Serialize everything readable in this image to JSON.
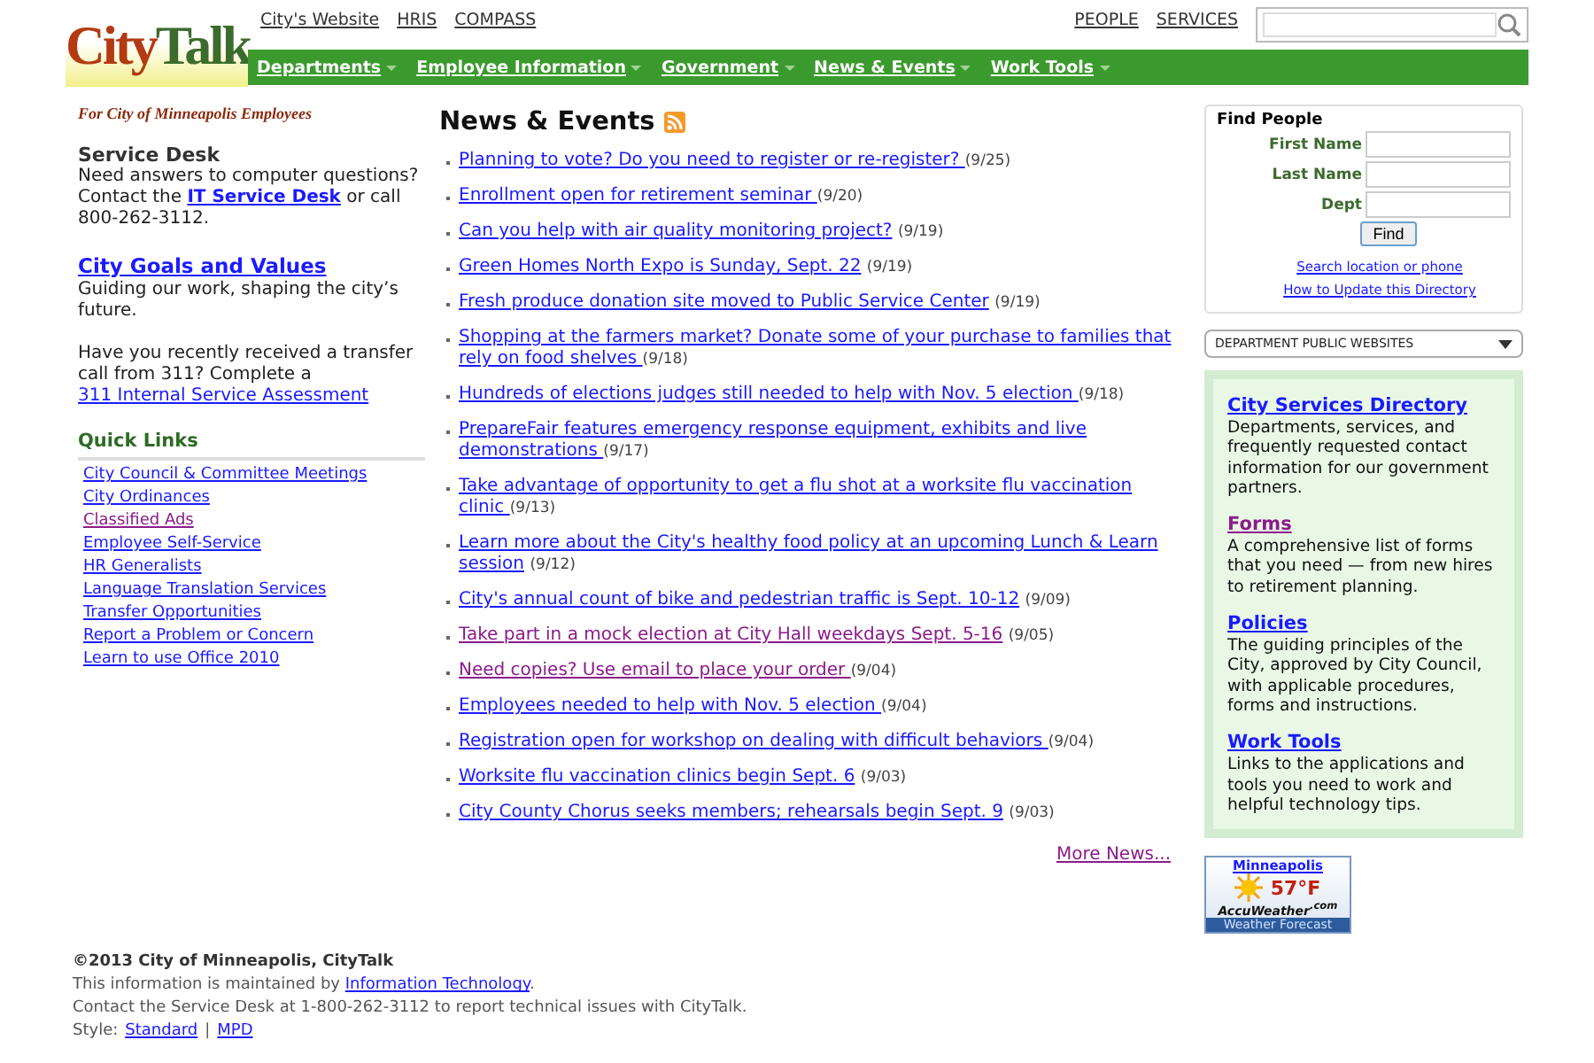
{
  "logo": {
    "first": "City",
    "second": "Talk"
  },
  "top_links": [
    {
      "label": "City's Website"
    },
    {
      "label": "HRIS"
    },
    {
      "label": "COMPASS"
    }
  ],
  "top_right_links": [
    {
      "label": "PEOPLE"
    },
    {
      "label": "SERVICES"
    }
  ],
  "nav": [
    {
      "label": "Departments"
    },
    {
      "label": "Employee Information"
    },
    {
      "label": "Government"
    },
    {
      "label": "News & Events"
    },
    {
      "label": "Work Tools"
    }
  ],
  "tagline": "For City of Minneapolis Employees",
  "service_desk": {
    "title": "Service Desk",
    "line": "Need answers to computer questions?",
    "before": "Contact the",
    "link": "IT Service Desk",
    "after": "or call 800-262-3112."
  },
  "goals": {
    "link": "City Goals and Values",
    "text": "Guiding our work, shaping the city’s future."
  },
  "transfer": {
    "before": "Have you recently received a transfer call from 311? Complete a",
    "link": "311 Internal Service Assessment"
  },
  "quick_links": {
    "title": "Quick Links",
    "items": [
      {
        "label": "City Council & Committee Meetings",
        "visited": false
      },
      {
        "label": "City Ordinances",
        "visited": false
      },
      {
        "label": "Classified Ads",
        "visited": true
      },
      {
        "label": "Employee Self-Service",
        "visited": false
      },
      {
        "label": "HR Generalists",
        "visited": false
      },
      {
        "label": "Language Translation Services",
        "visited": false
      },
      {
        "label": "Transfer Opportunities",
        "visited": false
      },
      {
        "label": "Report a Problem or Concern",
        "visited": false
      },
      {
        "label": "Learn to use Office 2010",
        "visited": false
      }
    ]
  },
  "news": {
    "title": "News & Events",
    "items": [
      {
        "label": "Planning to vote? Do you need to register or re-register? ",
        "date": "(9/25)",
        "visited": false
      },
      {
        "label": "Enrollment open for retirement seminar ",
        "date": "(9/20)",
        "visited": false
      },
      {
        "label": "Can you help with air quality monitoring project?",
        "date": "(9/19)",
        "visited": false
      },
      {
        "label": "Green Homes North Expo is Sunday, Sept. 22",
        "date": "(9/19)",
        "visited": false
      },
      {
        "label": "Fresh produce donation site moved to Public Service Center",
        "date": "(9/19)",
        "visited": false
      },
      {
        "label": "Shopping at the farmers market? Donate some of your purchase to families that rely on food shelves ",
        "date": "(9/18)",
        "visited": false
      },
      {
        "label": "Hundreds of elections judges still needed to help with Nov. 5 election ",
        "date": "(9/18)",
        "visited": false
      },
      {
        "label": "PrepareFair features emergency response equipment, exhibits and live demonstrations ",
        "date": "(9/17)",
        "visited": false
      },
      {
        "label": "Take advantage of opportunity to get a flu shot at a worksite flu vaccination clinic ",
        "date": "(9/13)",
        "visited": false
      },
      {
        "label": "Learn more about the City's healthy food policy at an upcoming Lunch & Learn session",
        "date": "(9/12)",
        "visited": false
      },
      {
        "label": "City's annual count of bike and pedestrian traffic is Sept. 10-12",
        "date": "(9/09)",
        "visited": false
      },
      {
        "label": "Take part in a mock election at City Hall weekdays Sept. 5-16",
        "date": "(9/05)",
        "visited": true
      },
      {
        "label": "Need copies? Use email to place your order ",
        "date": "(9/04)",
        "visited": true
      },
      {
        "label": "Employees needed to help with Nov. 5 election ",
        "date": "(9/04)",
        "visited": false
      },
      {
        "label": "Registration open for workshop on dealing with difficult behaviors ",
        "date": "(9/04)",
        "visited": false
      },
      {
        "label": "Worksite flu vaccination clinics begin Sept. 6",
        "date": "(9/03)",
        "visited": false
      },
      {
        "label": "City County Chorus seeks members; rehearsals begin Sept. 9",
        "date": "(9/03)",
        "visited": false
      }
    ],
    "more": "More News..."
  },
  "find_people": {
    "title": "Find People",
    "fields": [
      {
        "label": "First Name"
      },
      {
        "label": "Last Name"
      },
      {
        "label": "Dept"
      }
    ],
    "button": "Find",
    "links": [
      {
        "label": "Search location or phone"
      },
      {
        "label": "How to Update this Directory"
      }
    ]
  },
  "dept_select": {
    "value": "DEPARTMENT PUBLIC WEBSITES"
  },
  "services": [
    {
      "link": "City Services Directory",
      "text": "Departments, services, and frequently requested contact information for our government partners.",
      "visited": false
    },
    {
      "link": "Forms",
      "text": "A comprehensive list of forms that you need — from new hires to retirement planning.",
      "visited": true
    },
    {
      "link": "Policies",
      "text": "The guiding principles of the City, approved by City Council, with applicable procedures, forms and instructions.",
      "visited": false
    },
    {
      "link": "Work Tools",
      "text": "Links to the applications and tools you need to work and helpful technology tips.",
      "visited": false
    }
  ],
  "weather": {
    "city": "Minneapolis",
    "temp": "57°F",
    "brand": "AccuWeather$^{.com}$",
    "footer": "Weather Forecast"
  },
  "footer": {
    "copyright": "©2013 City of Minneapolis, CityTalk",
    "maintained_before": "This information is maintained by",
    "maintained_link": "Information Technology",
    "maintained_after": ".",
    "contact": "Contact the Service Desk at 1-800-262-3112 to report technical issues with CityTalk.",
    "style_label": "Style:",
    "styles": [
      {
        "label": "Standard"
      },
      {
        "label": "MPD"
      }
    ],
    "separator": "|"
  }
}
